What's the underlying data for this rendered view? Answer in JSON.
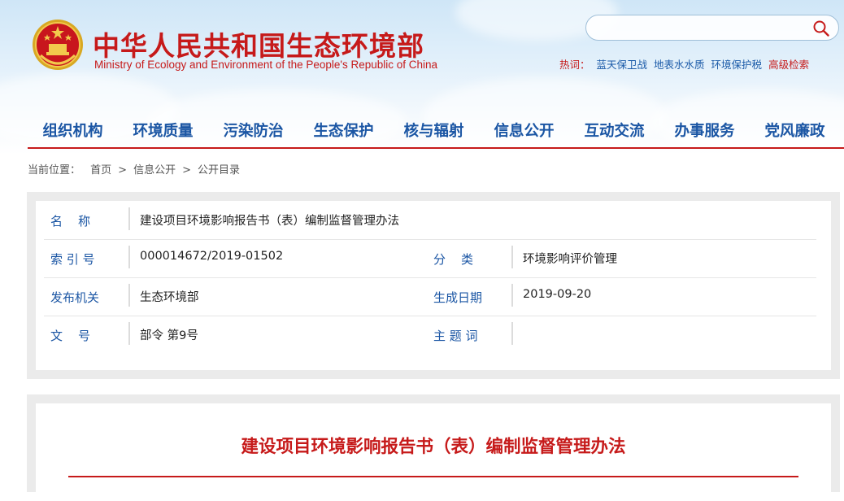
{
  "header": {
    "title_cn": "中华人民共和国生态环境部",
    "title_en": "Ministry of Ecology and Environment of the People's Republic of China",
    "accent_color": "#c61a1a",
    "emblem_icon": "national-emblem-icon"
  },
  "search": {
    "placeholder": "",
    "icon": "search-icon"
  },
  "hot_words": {
    "label": "热词：",
    "items": [
      "蓝天保卫战",
      "地表水水质",
      "环境保护税"
    ],
    "advanced": "高级检索"
  },
  "nav": {
    "items": [
      "组织机构",
      "环境质量",
      "污染防治",
      "生态保护",
      "核与辐射",
      "信息公开",
      "互动交流",
      "办事服务",
      "党风廉政"
    ],
    "color": "#1b56a4"
  },
  "breadcrumb": {
    "prefix": "当前位置：",
    "items": [
      "首页",
      "信息公开",
      "公开目录"
    ],
    "separator": ">"
  },
  "meta": {
    "name_label": "名　称",
    "name_value": "建设项目环境影响报告书（表）编制监督管理办法",
    "index_label": "索 引 号",
    "index_value": "000014672/2019-01502",
    "category_label": "分　类",
    "category_value": "环境影响评价管理",
    "issuer_label": "发布机关",
    "issuer_value": "生态环境部",
    "date_label": "生成日期",
    "date_value": "2019-09-20",
    "docno_label": "文　号",
    "docno_value": "部令 第9号",
    "subject_label": "主 题 词",
    "subject_value": ""
  },
  "document": {
    "title": "建设项目环境影响报告书（表）编制监督管理办法"
  }
}
